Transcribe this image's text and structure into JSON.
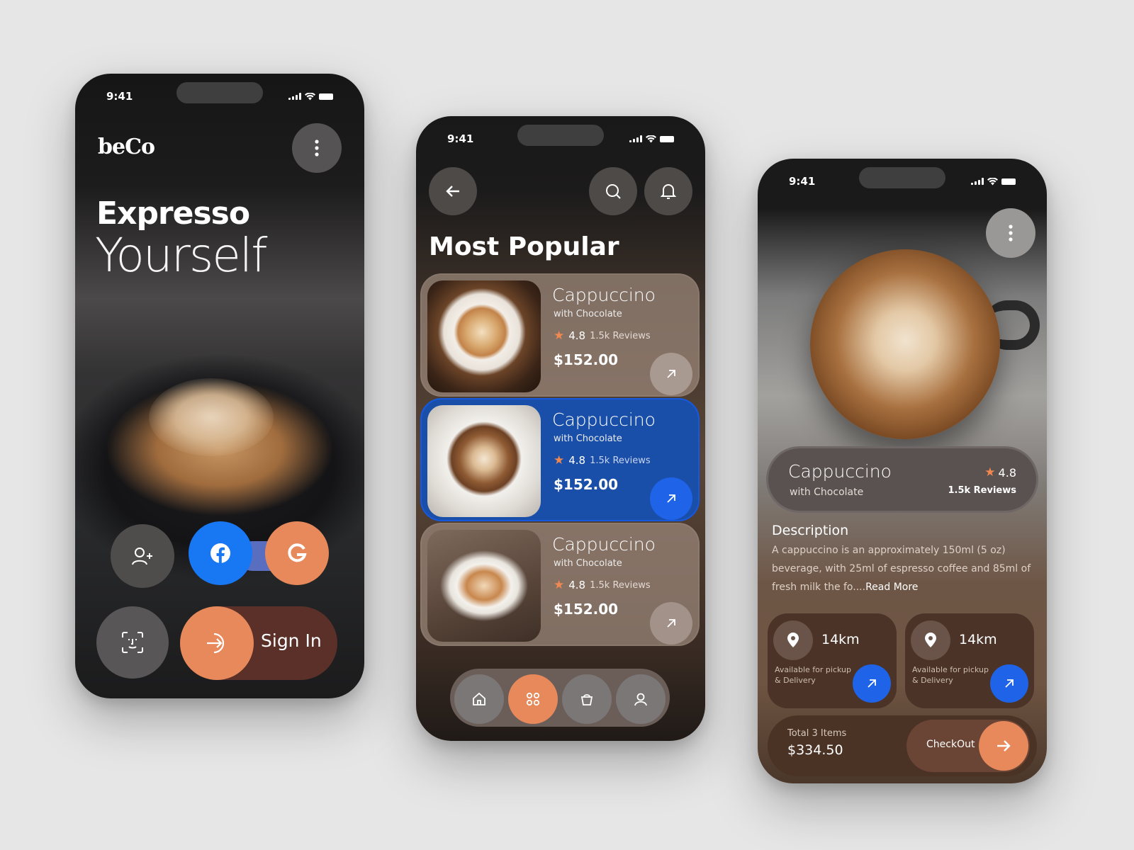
{
  "colors": {
    "accent_orange": "#e8895b",
    "accent_blue": "#1f63e8",
    "card_active": "#1a4fa9",
    "background": "#e6e6e6"
  },
  "phone1": {
    "time": "9:41",
    "brand": "beCo",
    "headline_1": "Expresso",
    "headline_2": "Yourself",
    "signin_label": "Sign In",
    "icons": [
      "menu-dots-icon",
      "add-user-icon",
      "facebook-icon",
      "google-icon",
      "face-id-icon",
      "sign-in-arrow-icon"
    ]
  },
  "phone2": {
    "time": "9:41",
    "title": "Most Popular",
    "items": [
      {
        "name": "Cappuccino",
        "subtitle": "with Chocolate",
        "rating": "4.8",
        "reviews": "1.5k Reviews",
        "price": "$152.00",
        "active": false
      },
      {
        "name": "Cappuccino",
        "subtitle": "with Chocolate",
        "rating": "4.8",
        "reviews": "1.5k Reviews",
        "price": "$152.00",
        "active": true
      },
      {
        "name": "Cappuccino",
        "subtitle": "with Chocolate",
        "rating": "4.8",
        "reviews": "1.5k Reviews",
        "price": "$152.00",
        "active": false
      }
    ],
    "nav": [
      "home-icon",
      "grid-icon",
      "bag-icon",
      "profile-icon"
    ],
    "nav_active": 1
  },
  "phone3": {
    "time": "9:41",
    "product_name": "Cappuccino",
    "product_sub": "with Chocolate",
    "rating": "4.8",
    "reviews": "1.5k Reviews",
    "desc_title": "Description",
    "desc_text": "A cappuccino is an approximately 150ml (5 oz) beverage, with 25ml of espresso coffee and 85ml of fresh milk the fo....",
    "read_more": "Read More",
    "locations": [
      {
        "distance": "14km",
        "subtitle": "Available for pickup & Delivery"
      },
      {
        "distance": "14km",
        "subtitle": "Available for pickup & Delivery"
      }
    ],
    "total_label": "Total 3 Items",
    "total_value": "$334.50",
    "checkout_label": "CheckOut"
  }
}
